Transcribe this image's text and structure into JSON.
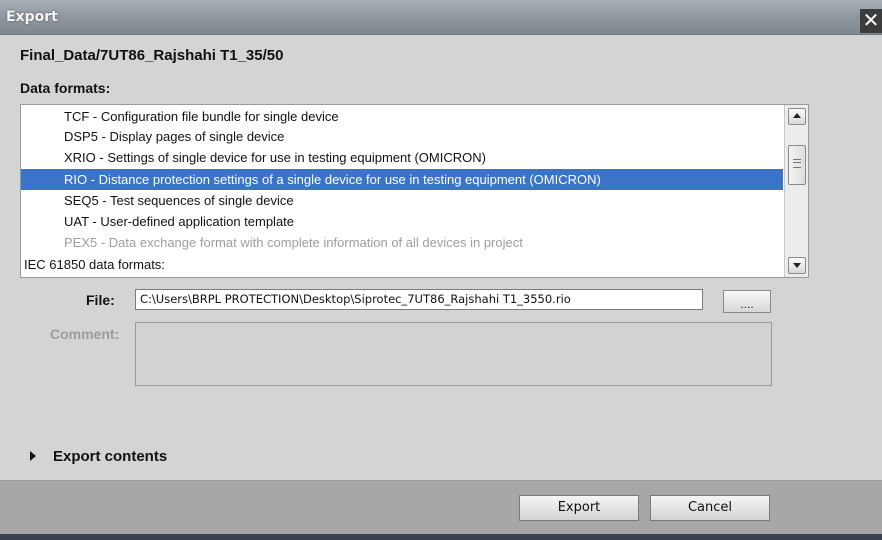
{
  "window": {
    "title": "Export",
    "close_glyph": "✕"
  },
  "header": {
    "path": "Final_Data/7UT86_Rajshahi T1_35/50",
    "formats_label": "Data formats:"
  },
  "formats": {
    "items": [
      {
        "label": "TCF - Configuration file bundle for single device",
        "state": "normal",
        "kind": "item"
      },
      {
        "label": "DSP5 - Display pages of single device",
        "state": "normal",
        "kind": "item"
      },
      {
        "label": "XRIO - Settings of single device for use in testing equipment (OMICRON)",
        "state": "normal",
        "kind": "item"
      },
      {
        "label": "RIO - Distance protection settings of a single device for use in testing equipment (OMICRON)",
        "state": "selected",
        "kind": "item"
      },
      {
        "label": "SEQ5 - Test sequences of single device",
        "state": "normal",
        "kind": "item"
      },
      {
        "label": "UAT - User-defined application template",
        "state": "normal",
        "kind": "item"
      },
      {
        "label": "PEX5 - Data exchange format with complete information of all devices in project",
        "state": "disabled",
        "kind": "item"
      },
      {
        "label": "IEC 61850 data formats:",
        "state": "normal",
        "kind": "group"
      }
    ]
  },
  "file": {
    "label": "File:",
    "value": "C:\\Users\\BRPL PROTECTION\\Desktop\\Siprotec_7UT86_Rajshahi T1_3550.rio",
    "browse_label": "...."
  },
  "comment": {
    "label": "Comment:"
  },
  "export_contents": {
    "label": "Export contents"
  },
  "footer": {
    "export_label": "Export",
    "cancel_label": "Cancel"
  },
  "colors": {
    "selection": "#3a73c8",
    "dialog_bg": "#d4d4d4",
    "footer_bg": "#a7a7a7"
  }
}
